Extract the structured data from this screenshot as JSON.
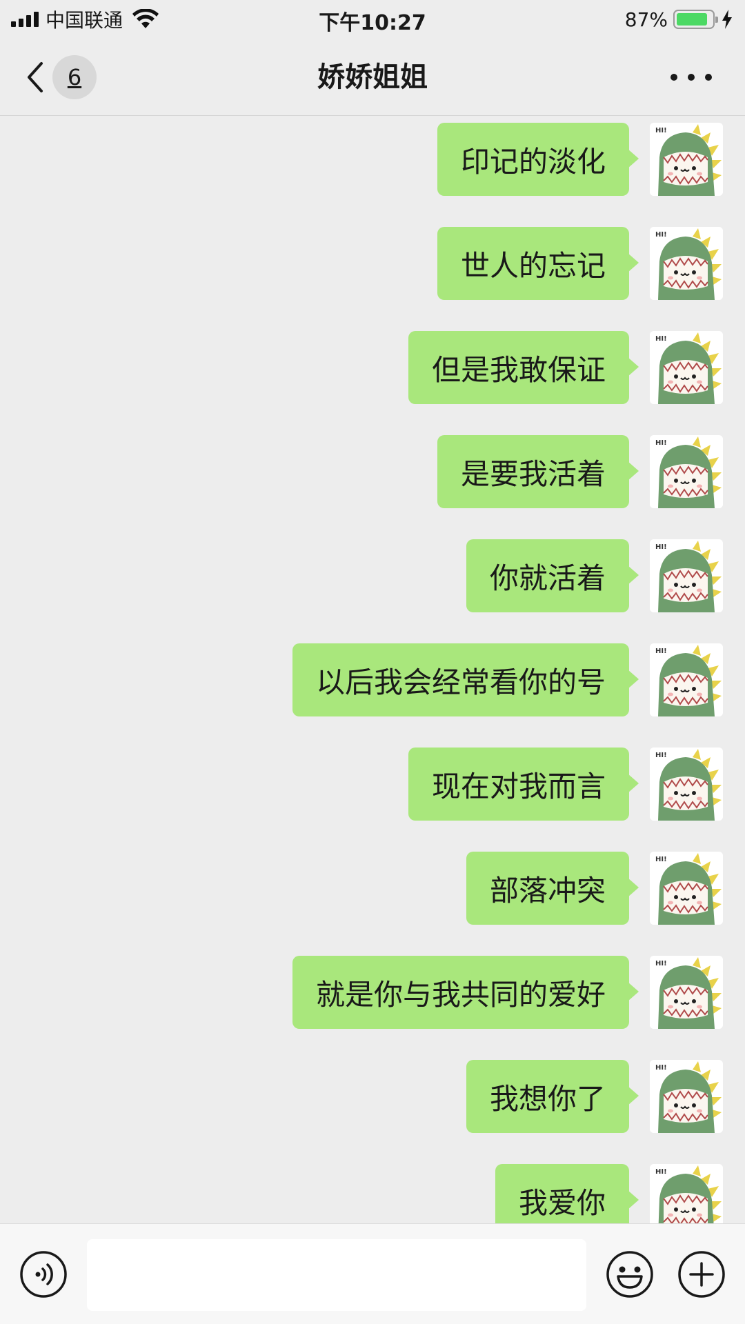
{
  "status_bar": {
    "carrier": "中国联通",
    "time": "下午10:27",
    "battery_percent": "87%",
    "battery_level": 0.87
  },
  "nav": {
    "back_unread_count": "6",
    "title": "娇娇姐姐"
  },
  "messages": [
    {
      "text": "印记的淡化",
      "sender": "me"
    },
    {
      "text": "世人的忘记",
      "sender": "me"
    },
    {
      "text": "但是我敢保证",
      "sender": "me"
    },
    {
      "text": "是要我活着",
      "sender": "me"
    },
    {
      "text": "你就活着",
      "sender": "me"
    },
    {
      "text": "以后我会经常看你的号",
      "sender": "me"
    },
    {
      "text": "现在对我而言",
      "sender": "me"
    },
    {
      "text": "部落冲突",
      "sender": "me"
    },
    {
      "text": "就是你与我共同的爱好",
      "sender": "me"
    },
    {
      "text": "我想你了",
      "sender": "me"
    },
    {
      "text": "我爱你",
      "sender": "me"
    }
  ],
  "avatar": {
    "icon": "green-dinosaur-avatar",
    "sign_text": "HI!"
  },
  "input_bar": {
    "value": "",
    "voice_icon": "voice-icon",
    "emoji_icon": "emoji-icon",
    "plus_icon": "plus-icon"
  },
  "colors": {
    "background": "#ededed",
    "bubble_me": "#a9e77c",
    "battery_fill": "#4cd964",
    "avatar_green": "#6f9e6d",
    "avatar_yellow": "#e8d24a"
  }
}
